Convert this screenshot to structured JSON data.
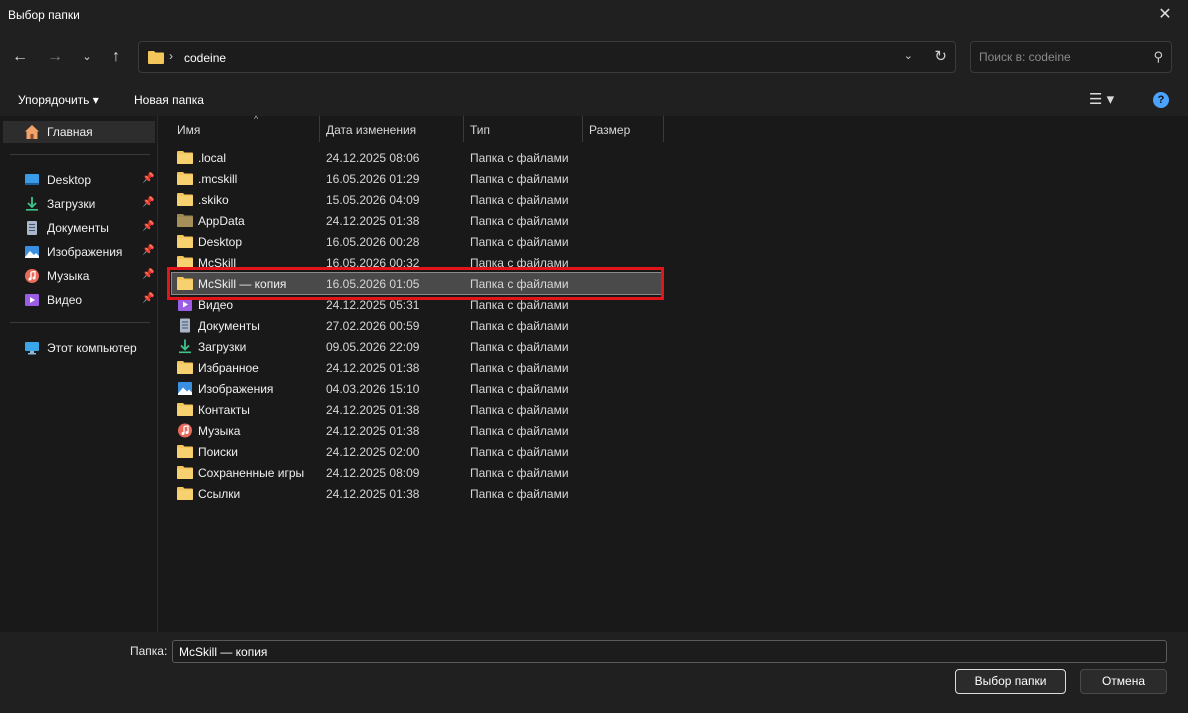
{
  "window": {
    "title": "Выбор папки"
  },
  "nav": {
    "path_segment": "codeine",
    "search_placeholder": "Поиск в: codeine"
  },
  "toolbar": {
    "organize_label": "Упорядочить ▾",
    "new_folder_label": "Новая папка"
  },
  "sidebar": {
    "home_label": "Главная",
    "pinned": [
      {
        "label": "Desktop",
        "icon": "desktop-icon"
      },
      {
        "label": "Загрузки",
        "icon": "download-icon"
      },
      {
        "label": "Документы",
        "icon": "documents-icon"
      },
      {
        "label": "Изображения",
        "icon": "pictures-icon"
      },
      {
        "label": "Музыка",
        "icon": "music-icon"
      },
      {
        "label": "Видео",
        "icon": "video-icon"
      }
    ],
    "this_pc_label": "Этот компьютер"
  },
  "columns": {
    "name": "Имя",
    "date": "Дата изменения",
    "type": "Тип",
    "size": "Размер"
  },
  "files": [
    {
      "name": ".local",
      "date": "24.12.2025 08:06",
      "type": "Папка с файлами",
      "icon": "folder-icon"
    },
    {
      "name": ".mcskill",
      "date": "16.05.2026 01:29",
      "type": "Папка с файлами",
      "icon": "folder-icon"
    },
    {
      "name": ".skiko",
      "date": "15.05.2026 04:09",
      "type": "Папка с файлами",
      "icon": "folder-icon"
    },
    {
      "name": "AppData",
      "date": "24.12.2025 01:38",
      "type": "Папка с файлами",
      "icon": "folder-hidden-icon"
    },
    {
      "name": "Desktop",
      "date": "16.05.2026 00:28",
      "type": "Папка с файлами",
      "icon": "folder-icon"
    },
    {
      "name": "McSkill",
      "date": "16.05.2026 00:32",
      "type": "Папка с файлами",
      "icon": "folder-icon"
    },
    {
      "name": "McSkill — копия",
      "date": "16.05.2026 01:05",
      "type": "Папка с файлами",
      "icon": "folder-icon",
      "selected": true
    },
    {
      "name": "Видео",
      "date": "24.12.2025 05:31",
      "type": "Папка с файлами",
      "icon": "video-icon"
    },
    {
      "name": "Документы",
      "date": "27.02.2026 00:59",
      "type": "Папка с файлами",
      "icon": "documents-icon"
    },
    {
      "name": "Загрузки",
      "date": "09.05.2026 22:09",
      "type": "Папка с файлами",
      "icon": "download-icon"
    },
    {
      "name": "Избранное",
      "date": "24.12.2025 01:38",
      "type": "Папка с файлами",
      "icon": "folder-icon"
    },
    {
      "name": "Изображения",
      "date": "04.03.2026 15:10",
      "type": "Папка с файлами",
      "icon": "pictures-icon"
    },
    {
      "name": "Контакты",
      "date": "24.12.2025 01:38",
      "type": "Папка с файлами",
      "icon": "folder-icon"
    },
    {
      "name": "Музыка",
      "date": "24.12.2025 01:38",
      "type": "Папка с файлами",
      "icon": "music-icon"
    },
    {
      "name": "Поиски",
      "date": "24.12.2025 02:00",
      "type": "Папка с файлами",
      "icon": "folder-icon"
    },
    {
      "name": "Сохраненные игры",
      "date": "24.12.2025 08:09",
      "type": "Папка с файлами",
      "icon": "folder-icon"
    },
    {
      "name": "Ссылки",
      "date": "24.12.2025 01:38",
      "type": "Папка с файлами",
      "icon": "folder-icon"
    }
  ],
  "footer": {
    "folder_label": "Папка:",
    "folder_value": "McSkill — копия",
    "select_label": "Выбор папки",
    "cancel_label": "Отмена"
  },
  "colors": {
    "highlight": "#e4141b",
    "folder": "#f4c55a",
    "accent": "#4aa3ff"
  }
}
